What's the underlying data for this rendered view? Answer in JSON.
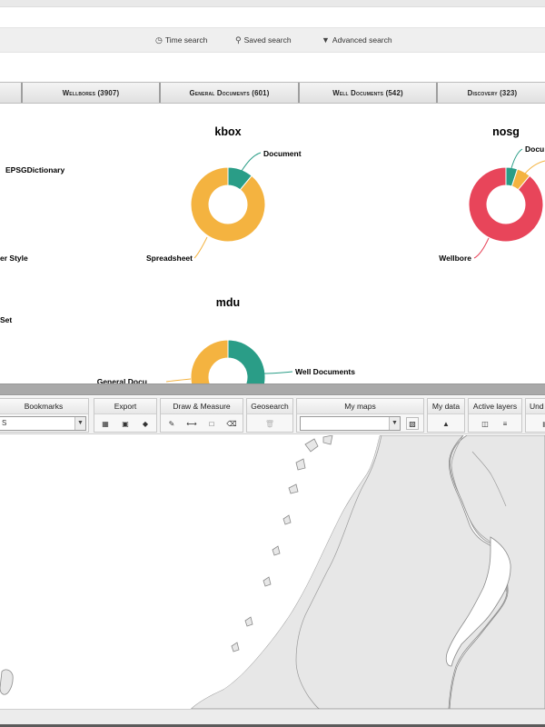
{
  "search_bar": {
    "time_search": "Time search",
    "saved_search": "Saved search",
    "advanced_search": "Advanced search"
  },
  "tabs": [
    {
      "label": "Wellbores (3907)"
    },
    {
      "label": "General Documents (601)"
    },
    {
      "label": "Well Documents (542)"
    },
    {
      "label": "Discovery (323)"
    }
  ],
  "left_labels": {
    "epsg": "EPSGDictionary",
    "style": "er Style",
    "set": "Set"
  },
  "colors": {
    "teal": "#2a9d87",
    "orange": "#f4b340",
    "red": "#e8455a",
    "leader_teal": "#2a9d87",
    "leader_orange": "#f4b340",
    "leader_red": "#e8455a"
  },
  "chart_data": [
    {
      "type": "pie",
      "title": "kbox",
      "labels": [
        "Document",
        "Spreadsheet"
      ],
      "values": [
        11,
        89
      ]
    },
    {
      "type": "pie",
      "title": "nosg",
      "labels": [
        "Docu",
        "",
        "Wellbore"
      ],
      "values": [
        5,
        6,
        89
      ]
    },
    {
      "type": "pie",
      "title": "mdu",
      "labels": [
        "Well Documents",
        "General Docu"
      ],
      "values": [
        47,
        53
      ]
    }
  ],
  "toolbar": {
    "bookmarks": "Bookmarks",
    "bookmarks_value": "S",
    "export": "Export",
    "draw_measure": "Draw & Measure",
    "geosearch": "Geosearch",
    "my_maps": "My maps",
    "my_data": "My data",
    "active_layers": "Active layers",
    "undo": "Und"
  }
}
